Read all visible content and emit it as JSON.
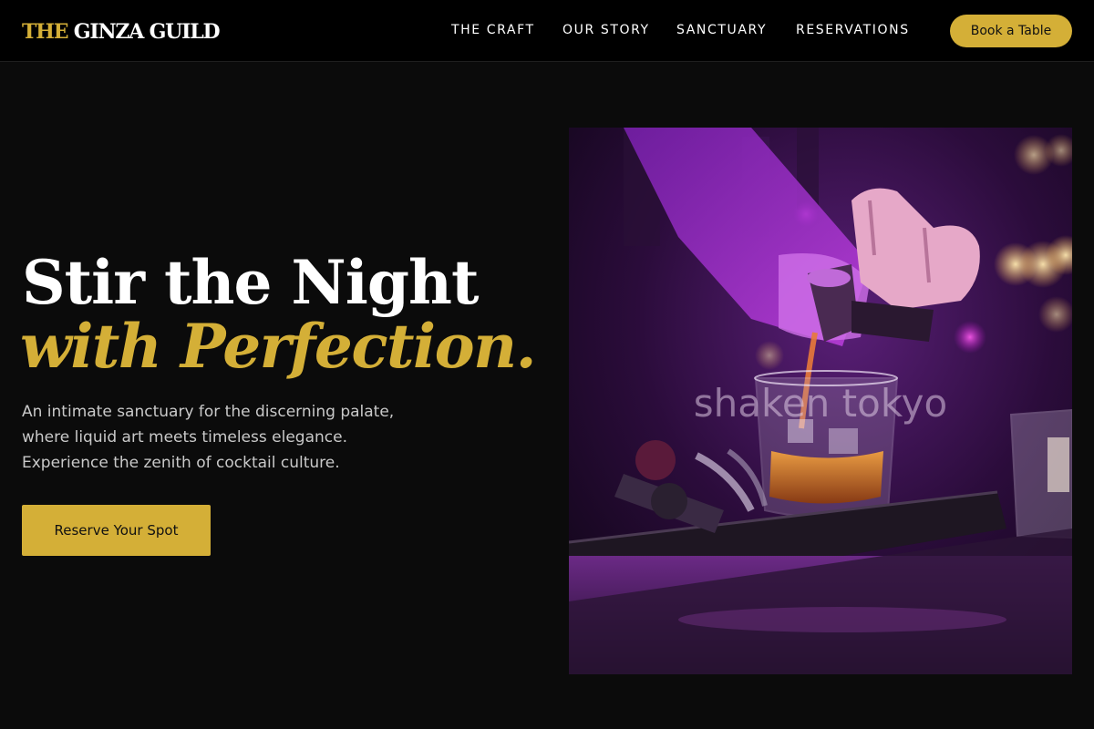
{
  "header": {
    "logo_gold": "THE",
    "logo_white": "GINZA GUILD",
    "nav": [
      "THE CRAFT",
      "OUR STORY",
      "SANCTUARY",
      "RESERVATIONS"
    ],
    "cta_label": "Book a Table"
  },
  "hero": {
    "title_line1": "Stir the Night",
    "title_line2": "with Perfection.",
    "description_lines": [
      "An intimate sanctuary for the discerning palate,",
      "where liquid art meets timeless elegance.",
      "Experience the zenith of cocktail culture."
    ],
    "cta_label": "Reserve Your Spot",
    "image_watermark": "shaken tokyo"
  },
  "colors": {
    "accent_gold": "#d4af37",
    "background": "#0b0b0b",
    "header_background": "#000000"
  }
}
